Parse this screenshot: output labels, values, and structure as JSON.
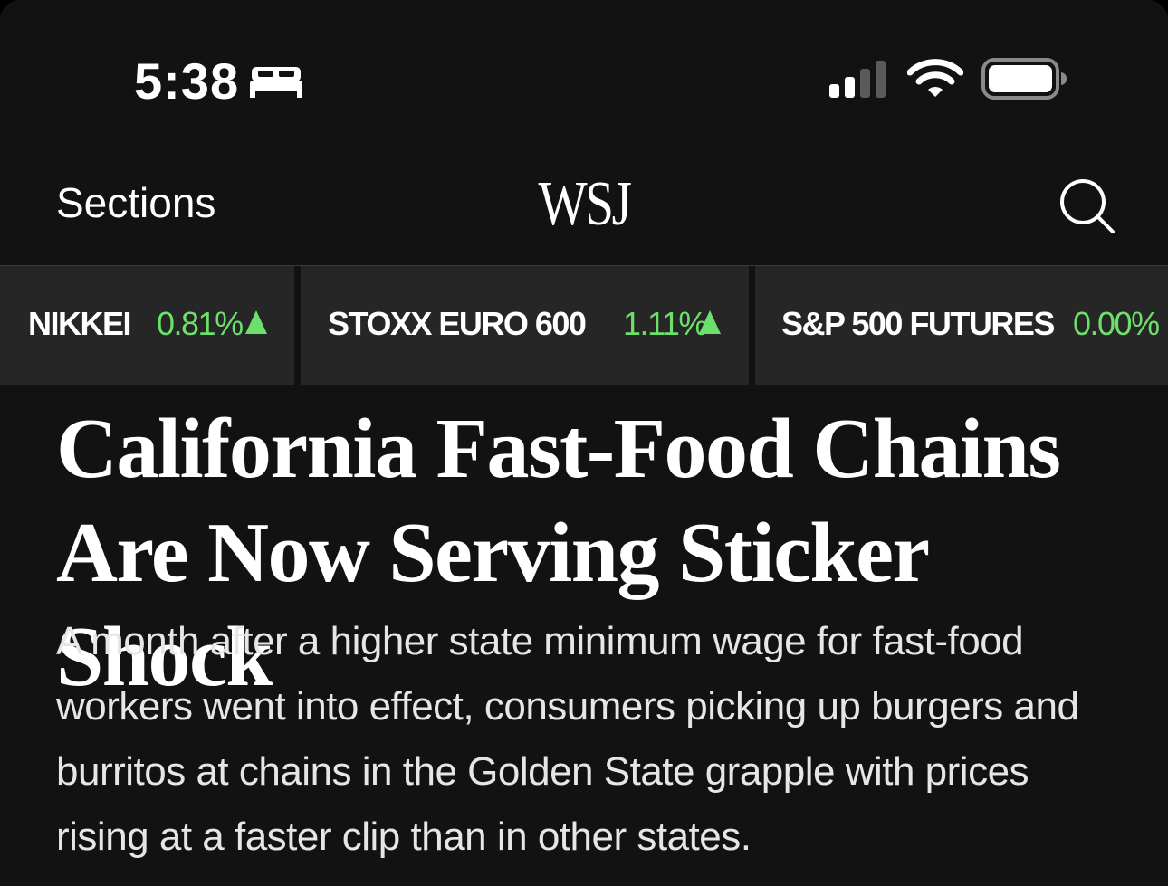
{
  "status_bar": {
    "time": "5:38",
    "focus_icon": "bed-icon",
    "signal_icon": "cellular-signal-icon",
    "wifi_icon": "wifi-icon",
    "battery_icon": "battery-icon",
    "signal_bars_active": 2,
    "signal_bars_total": 4
  },
  "header": {
    "sections_label": "Sections",
    "logo_text": "WSJ",
    "search_icon": "search-icon"
  },
  "ticker": {
    "items": [
      {
        "name": "NIKKEI",
        "change": "0.81%",
        "direction": "up"
      },
      {
        "name": "STOXX EURO 600",
        "change": "1.11%",
        "direction": "up"
      },
      {
        "name": "S&P 500 FUTURES",
        "change": "0.00%",
        "direction": "none"
      }
    ],
    "colors": {
      "positive": "#6be06b",
      "tile_background": "#262626"
    }
  },
  "article": {
    "headline": "California Fast-Food Chains Are Now Serving Sticker Shock",
    "summary": "A month after a higher state minimum wage for fast-food workers went into effect, consumers picking up burgers and burritos at chains in the Golden State grapple with prices rising at a faster clip than in other states."
  },
  "theme": {
    "background": "#121212",
    "text": "#ffffff",
    "accent_up": "#6be06b"
  }
}
